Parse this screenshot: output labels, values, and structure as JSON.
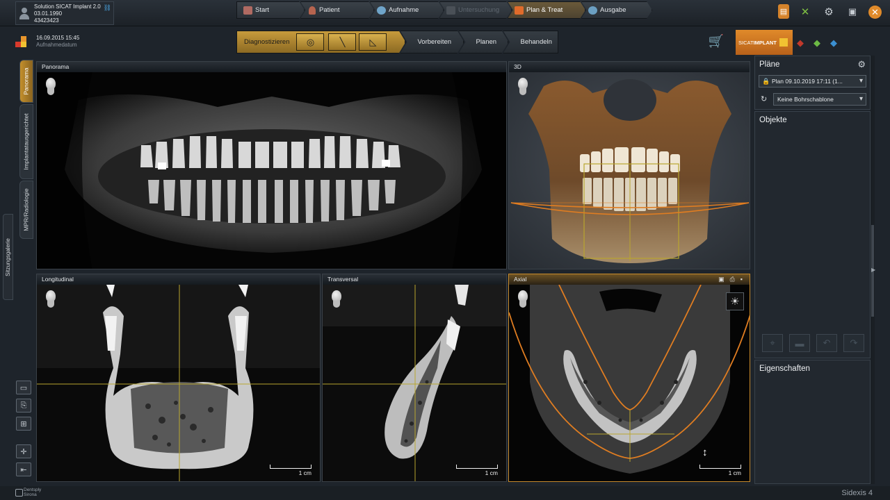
{
  "patient": {
    "name": "Solution SICAT Implant 2.0",
    "birthdate": "03.01.1990",
    "id": "43423423",
    "link_icon": "link-icon"
  },
  "workflow": [
    {
      "label": "Start",
      "icon": "home-icon",
      "state": "normal"
    },
    {
      "label": "Patient",
      "icon": "patient-icon",
      "state": "normal"
    },
    {
      "label": "Aufnahme",
      "icon": "acquisition-icon",
      "state": "normal"
    },
    {
      "label": "Untersuchung",
      "icon": "examination-icon",
      "state": "disabled"
    },
    {
      "label": "Plan & Treat",
      "icon": "plan-treat-icon",
      "state": "active"
    },
    {
      "label": "Ausgabe",
      "icon": "globe-icon",
      "state": "normal"
    }
  ],
  "study": {
    "datetime": "16.09.2015 15:45",
    "label": "Aufnahmedatum"
  },
  "diagnostic_steps": {
    "current": "Diagnostizieren",
    "steps": [
      "Vorbereiten",
      "Planen",
      "Behandeln"
    ]
  },
  "sicat": {
    "brand_light": "SICAT",
    "brand_bold": "IMPLANT"
  },
  "left_tabs": [
    "Panorama",
    "Implantatausgerichtet",
    "MPR/Radiologie"
  ],
  "gallery_tab": "Sitzungsgalerie",
  "viewports": {
    "panorama": {
      "title": "Panorama"
    },
    "view3d": {
      "title": "3D"
    },
    "longitudinal": {
      "title": "Longitudinal",
      "scale": "1 cm"
    },
    "transversal": {
      "title": "Transversal",
      "scale": "1 cm"
    },
    "axial": {
      "title": "Axial",
      "scale": "1 cm"
    }
  },
  "right_panel": {
    "plans_title": "Pläne",
    "plan_selected": "Plan 09.10.2019 17:11 (1...",
    "template_selected": "Keine Bohrschablone",
    "objects_title": "Objekte",
    "properties_title": "Eigenschaften"
  },
  "footer": {
    "brand_line1": "Dentsply",
    "brand_line2": "Sirona",
    "product": "Sidexis 4"
  },
  "colors": {
    "accent": "#c68a2b",
    "overlay_yellow": "#b9a62e",
    "overlay_orange": "#e07d21"
  }
}
